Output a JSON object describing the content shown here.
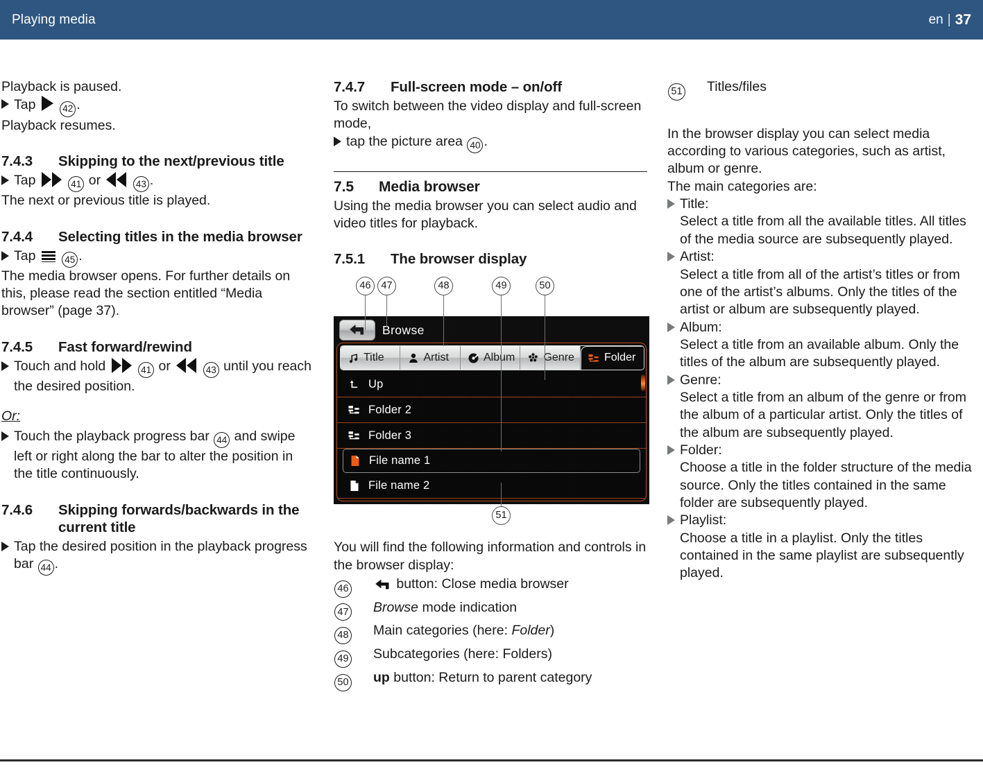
{
  "header": {
    "title": "Playing media",
    "language": "en",
    "separator": "|",
    "page_number": "37",
    "background_color": "#2e5680"
  },
  "col1": {
    "paused_line": "Playback is paused.",
    "tap_play_prefix": "Tap",
    "tap_play_ref": "42",
    "tap_play_suffix": ".",
    "resumes_line": "Playback resumes.",
    "s743": {
      "number": "7.4.3",
      "title": "Skipping to the next/previous title",
      "step_prefix": "Tap",
      "ref_next": "41",
      "or_word": "or",
      "ref_prev": "43",
      "step_suffix": ".",
      "result": "The next or previous title is played."
    },
    "s744": {
      "number": "7.4.4",
      "title": "Selecting titles in the media browser",
      "step_prefix": "Tap",
      "ref_menu": "45",
      "step_suffix": ".",
      "result": "The media browser opens. For further details on this, please read the section entitled “Media browser” (page 37)."
    },
    "s745": {
      "number": "7.4.5",
      "title": "Fast forward/rewind",
      "step_prefix": "Touch and hold",
      "ref_next": "41",
      "or_word": "or",
      "ref_prev": "43",
      "step_suffix": "until you reach the desired position.",
      "or_label": "Or:",
      "alt_step_a": "Touch the playback progress bar",
      "alt_ref": "44",
      "alt_step_b": "and swipe left or right along the bar to alter the position in the title continuously."
    },
    "s746": {
      "number": "7.4.6",
      "title": "Skipping forwards/backwards in the current title",
      "step_a": "Tap the desired position in the playback progress bar",
      "step_ref": "44",
      "step_b": "."
    }
  },
  "col2": {
    "s747": {
      "number": "7.4.7",
      "title": "Full-screen mode – on/off",
      "intro": "To switch between the video display and full-screen mode,",
      "step_a": "tap the picture area",
      "step_ref": "40",
      "step_b": "."
    },
    "s75": {
      "number": "7.5",
      "title": "Media browser",
      "intro": "Using the media browser you can select audio and video titles for playback."
    },
    "s751": {
      "number": "7.5.1",
      "title": "The browser display"
    },
    "figure": {
      "callouts": [
        "46",
        "47",
        "48",
        "49",
        "50",
        "51"
      ],
      "back_button_icon": "back-arrow-icon",
      "mode_label": "Browse",
      "tabs": [
        {
          "label": "Title",
          "icon": "music-note-icon",
          "active": false
        },
        {
          "label": "Artist",
          "icon": "person-icon",
          "active": false
        },
        {
          "label": "Album",
          "icon": "disc-icon",
          "active": false
        },
        {
          "label": "Genre",
          "icon": "genre-cluster-icon",
          "active": false
        },
        {
          "label": "Folder",
          "icon": "folder-tree-icon",
          "active": true
        }
      ],
      "rows": [
        {
          "label": "Up",
          "icon": "up-arrow-icon",
          "selected": false,
          "accent": false
        },
        {
          "label": "Folder 2",
          "icon": "folder-tree-icon",
          "selected": false,
          "accent": false
        },
        {
          "label": "Folder 3",
          "icon": "folder-tree-icon",
          "selected": false,
          "accent": false
        },
        {
          "label": "File name 1",
          "icon": "file-icon",
          "selected": true,
          "accent": true
        },
        {
          "label": "File name 2",
          "icon": "file-icon",
          "selected": false,
          "accent": false
        }
      ],
      "accent_color": "#ef5a14",
      "border_color": "#b9501c",
      "scrollbar": "scrollbar-thumb"
    },
    "legend_intro": "You will find the following information and controls in the browser display:",
    "legend": [
      {
        "num": "46",
        "text_before": "",
        "icon": "back-arrow-icon",
        "text_after": "button: Close media browser"
      },
      {
        "num": "47",
        "italic": "Browse",
        "text_after": "mode indication"
      },
      {
        "num": "48",
        "text_before": "Main categories (here:",
        "italic": "Folder",
        "text_after": ")"
      },
      {
        "num": "49",
        "text_before": "Subcategories (here: Folders)"
      },
      {
        "num": "50",
        "bold": "up",
        "text_after": "button: Return to parent category"
      }
    ]
  },
  "col3": {
    "entry51": {
      "num": "51",
      "label": "Titles/files"
    },
    "intro": "In the browser display you can select media according to various categories, such as artist, album or genre.",
    "main_categories_line": "The main categories are:",
    "categories": [
      {
        "name": "Title:",
        "desc": "Select a title from all the available titles. All titles of the media source are subsequently played."
      },
      {
        "name": "Artist:",
        "desc": "Select a title from all of the artist’s titles or from one of the artist’s albums. Only the titles of the artist or album are subsequently played."
      },
      {
        "name": "Album:",
        "desc": "Select a title from an available album. Only the titles of the album are subsequently played."
      },
      {
        "name": "Genre:",
        "desc": "Select a title from an album of the genre or from the album of a particular artist. Only the titles of the album are subsequently played."
      },
      {
        "name": "Folder:",
        "desc": "Choose a title in the folder structure of the media source. Only the titles contained in the same folder are subsequently played."
      },
      {
        "name": "Playlist:",
        "desc": "Choose a title in a playlist. Only the titles contained in the same playlist are subsequently played."
      }
    ]
  }
}
